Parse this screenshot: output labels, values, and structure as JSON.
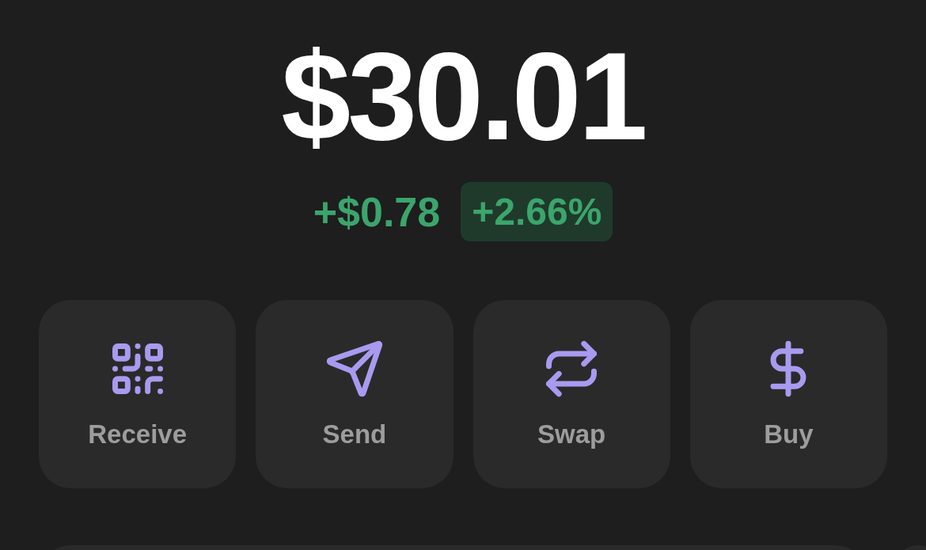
{
  "balance": "$30.01",
  "change": {
    "amount": "+$0.78",
    "percent": "+2.66%"
  },
  "actions": [
    {
      "label": "Receive",
      "kind": "receive"
    },
    {
      "label": "Send",
      "kind": "send"
    },
    {
      "label": "Swap",
      "kind": "swap"
    },
    {
      "label": "Buy",
      "kind": "buy"
    }
  ]
}
